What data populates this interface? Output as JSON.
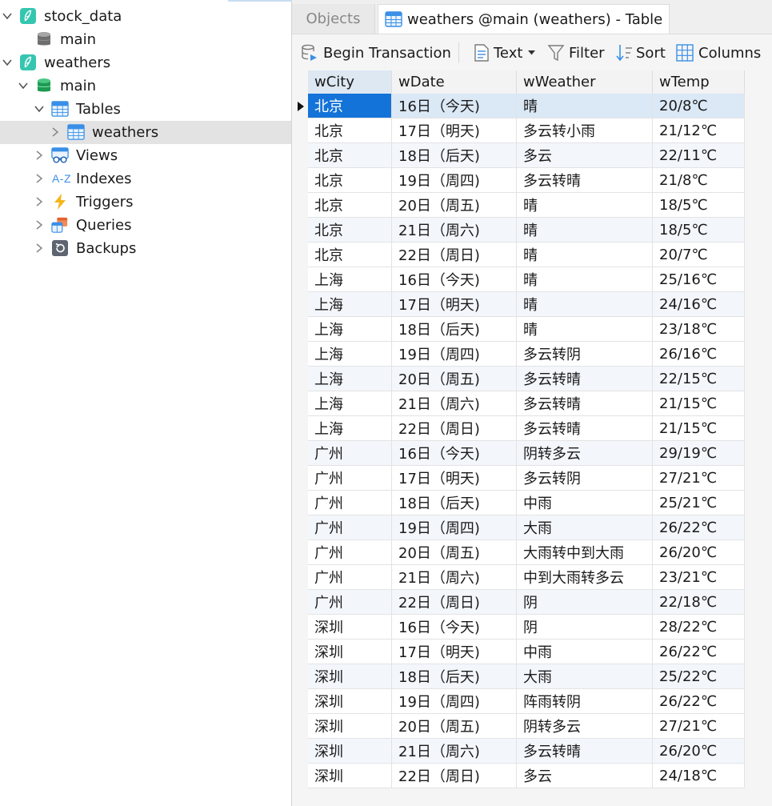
{
  "sidebar": {
    "items": [
      {
        "label": "stock_data",
        "icon": "sqlite-feather-icon",
        "level": 0,
        "expanded": true
      },
      {
        "label": "main",
        "icon": "database-gray-icon",
        "level": 1
      },
      {
        "label": "weathers",
        "icon": "sqlite-feather-icon",
        "level": 0,
        "expanded": true
      },
      {
        "label": "main",
        "icon": "database-green-icon",
        "level": 1,
        "expanded": true
      },
      {
        "label": "Tables",
        "icon": "tables-icon",
        "level": 2,
        "expanded": true
      },
      {
        "label": "weathers",
        "icon": "table-icon",
        "level": 3,
        "expanded": false,
        "selected": true
      },
      {
        "label": "Views",
        "icon": "views-icon",
        "level": 2,
        "expanded": false
      },
      {
        "label": "Indexes",
        "icon": "indexes-icon",
        "level": 2,
        "expanded": false,
        "icon_text": "A-Z"
      },
      {
        "label": "Triggers",
        "icon": "triggers-icon",
        "level": 2,
        "expanded": false
      },
      {
        "label": "Queries",
        "icon": "queries-icon",
        "level": 2,
        "expanded": false
      },
      {
        "label": "Backups",
        "icon": "backups-icon",
        "level": 2,
        "expanded": false
      }
    ]
  },
  "tabs": {
    "objects": "Objects",
    "table": "weathers @main (weathers) - Table"
  },
  "toolbar": {
    "begin_transaction": "Begin Transaction",
    "text": "Text",
    "filter": "Filter",
    "sort": "Sort",
    "columns": "Columns"
  },
  "grid": {
    "columns": [
      "wCity",
      "wDate",
      "wWeather",
      "wTemp"
    ],
    "rows": [
      [
        "北京",
        "16日（今天)",
        "晴",
        "20/8℃"
      ],
      [
        "北京",
        "17日（明天)",
        "多云转小雨",
        "21/12℃"
      ],
      [
        "北京",
        "18日（后天)",
        "多云",
        "22/11℃"
      ],
      [
        "北京",
        "19日（周四)",
        "多云转晴",
        "21/8℃"
      ],
      [
        "北京",
        "20日（周五)",
        "晴",
        "18/5℃"
      ],
      [
        "北京",
        "21日（周六)",
        "晴",
        "18/5℃"
      ],
      [
        "北京",
        "22日（周日)",
        "晴",
        "20/7℃"
      ],
      [
        "上海",
        "16日（今天)",
        "晴",
        "25/16℃"
      ],
      [
        "上海",
        "17日（明天)",
        "晴",
        "24/16℃"
      ],
      [
        "上海",
        "18日（后天)",
        "晴",
        "23/18℃"
      ],
      [
        "上海",
        "19日（周四)",
        "多云转阴",
        "26/16℃"
      ],
      [
        "上海",
        "20日（周五)",
        "多云转晴",
        "22/15℃"
      ],
      [
        "上海",
        "21日（周六)",
        "多云转晴",
        "21/15℃"
      ],
      [
        "上海",
        "22日（周日)",
        "多云转晴",
        "21/15℃"
      ],
      [
        "广州",
        "16日（今天)",
        "阴转多云",
        "29/19℃"
      ],
      [
        "广州",
        "17日（明天)",
        "多云转阴",
        "27/21℃"
      ],
      [
        "广州",
        "18日（后天)",
        "中雨",
        "25/21℃"
      ],
      [
        "广州",
        "19日（周四)",
        "大雨",
        "26/22℃"
      ],
      [
        "广州",
        "20日（周五)",
        "大雨转中到大雨",
        "26/20℃"
      ],
      [
        "广州",
        "21日（周六)",
        "中到大雨转多云",
        "23/21℃"
      ],
      [
        "广州",
        "22日（周日)",
        "阴",
        "22/18℃"
      ],
      [
        "深圳",
        "16日（今天)",
        "阴",
        "28/22℃"
      ],
      [
        "深圳",
        "17日（明天)",
        "中雨",
        "26/22℃"
      ],
      [
        "深圳",
        "18日（后天)",
        "大雨",
        "25/22℃"
      ],
      [
        "深圳",
        "19日（周四)",
        "阵雨转阴",
        "26/22℃"
      ],
      [
        "深圳",
        "20日（周五)",
        "阴转多云",
        "27/21℃"
      ],
      [
        "深圳",
        "21日（周六)",
        "多云转晴",
        "26/20℃"
      ],
      [
        "深圳",
        "22日（周日)",
        "多云",
        "24/18℃"
      ]
    ]
  },
  "colors": {
    "selected_cell": "#1473d8",
    "selected_row": "#dbe8f6",
    "alt_row": "#f3f7fc",
    "sqlite_teal": "#35c6b0",
    "db_green": "#21a65a",
    "table_blue": "#3a8fe6"
  }
}
